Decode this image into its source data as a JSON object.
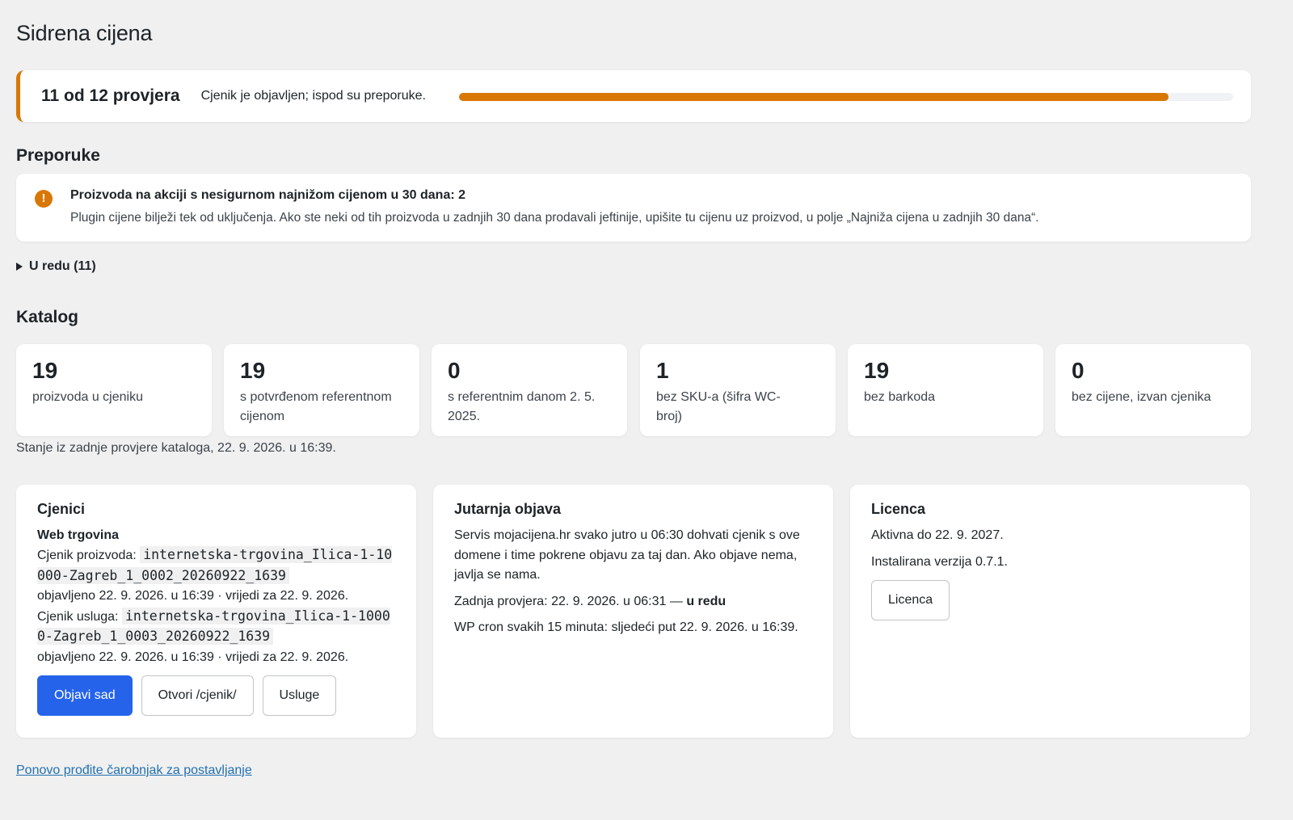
{
  "page": {
    "title": "Sidrena cijena"
  },
  "status": {
    "count_label": "11 od 12 provjera",
    "message": "Cjenik je objavljen; ispod su preporuke.",
    "progress_fraction": 0.917,
    "accent_color": "#d97706"
  },
  "recommendations": {
    "heading": "Preporuke",
    "items": [
      {
        "icon": "warning-icon",
        "title": "Proizvoda na akciji s nesigurnom najnižom cijenom u 30 dana: 2",
        "description": "Plugin cijene bilježi tek od uključenja. Ako ste neki od tih proizvoda u zadnjih 30 dana prodavali jeftinije, upišite tu cijenu uz proizvod, u polje „Najniža cijena u zadnjih 30 dana“."
      }
    ],
    "ok_toggle_label": "U redu (11)"
  },
  "catalog": {
    "heading": "Katalog",
    "stats": [
      {
        "value": "19",
        "label": "proizvoda u cjeniku"
      },
      {
        "value": "19",
        "label": "s potvrđenom referentnom cijenom"
      },
      {
        "value": "0",
        "label": "s referentnim danom 2. 5. 2025."
      },
      {
        "value": "1",
        "label": "bez SKU-a (šifra WC-broj)"
      },
      {
        "value": "19",
        "label": "bez barkoda"
      },
      {
        "value": "0",
        "label": "bez cijene, izvan cjenika"
      }
    ],
    "note": "Stanje iz zadnje provjere kataloga, 22. 9. 2026. u 16:39."
  },
  "cjenici": {
    "title": "Cjenici",
    "store_name": "Web trgovina",
    "products_label": "Cjenik proizvoda:",
    "products_file": "internetska-trgovina_Ilica-1-10000-Zagreb_1_0002_20260922_1639",
    "products_meta": "objavljeno 22. 9. 2026. u 16:39 · vrijedi za 22. 9. 2026.",
    "services_label": "Cjenik usluga:",
    "services_file": "internetska-trgovina_Ilica-1-10000-Zagreb_1_0003_20260922_1639",
    "services_meta": "objavljeno 22. 9. 2026. u 16:39 · vrijedi za 22. 9. 2026.",
    "publish_button": "Objavi sad",
    "open_button": "Otvori /cjenik/",
    "services_button": "Usluge",
    "primary_color": "#2563eb"
  },
  "morning": {
    "title": "Jutarnja objava",
    "description": "Servis mojacijena.hr svako jutro u 06:30 dohvati cjenik s ove domene i time pokrene objavu za taj dan. Ako objave nema, javlja se nama.",
    "last_check_prefix": "Zadnja provjera: 22. 9. 2026. u 06:31 —",
    "last_check_status": "u redu",
    "cron_note": "WP cron svakih 15 minuta: sljedeći put 22. 9. 2026. u 16:39."
  },
  "license": {
    "title": "Licenca",
    "active_until": "Aktivna do 22. 9. 2027.",
    "version": "Instalirana verzija 0.7.1.",
    "button": "Licenca"
  },
  "footer": {
    "wizard_link": "Ponovo prođite čarobnjak za postavljanje"
  }
}
